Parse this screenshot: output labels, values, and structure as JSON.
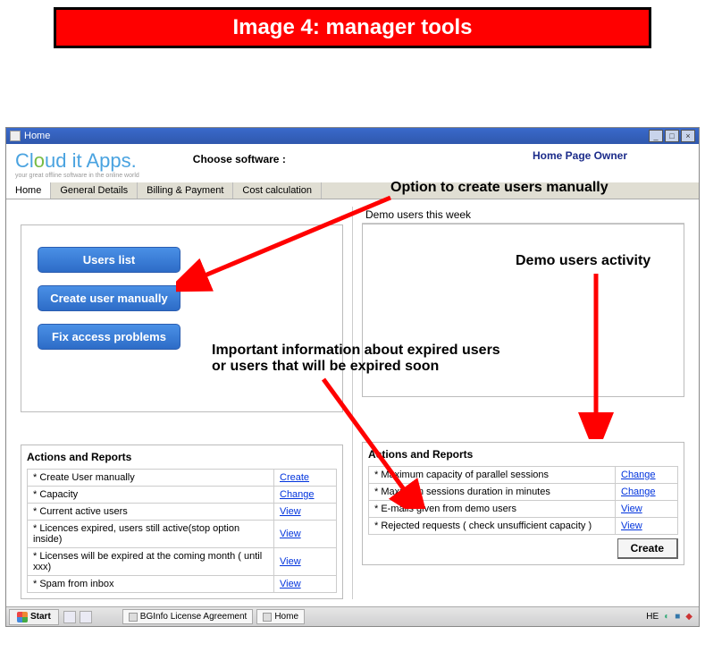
{
  "banner": "Image 4:  manager tools",
  "window_title": "Home",
  "logo": {
    "first": "Cl",
    "o": "o",
    "mid": "ud it Apps.",
    "tagline": "your great offline software in the online world"
  },
  "choose_software": "Choose software :",
  "home_page_owner": "Home Page Owner",
  "tabs": [
    "Home",
    "General Details",
    "Billing & Payment",
    "Cost calculation"
  ],
  "left": {
    "buttons": {
      "users_list": "Users list",
      "create_user": "Create user manually",
      "fix_access": "Fix  access problems"
    }
  },
  "right": {
    "demo_header": "Demo users this  week"
  },
  "reports_left": {
    "title": "Actions and Reports",
    "rows": [
      {
        "label": "* Create User manually",
        "action": "Create"
      },
      {
        "label": "* Capacity",
        "action": "Change"
      },
      {
        "label": "* Current active users",
        "action": "View"
      },
      {
        "label": "* Licences expired, users still active(stop option inside)",
        "action": "View"
      },
      {
        "label": "* Licenses will be expired at the coming month ( until xxx)",
        "action": "View"
      },
      {
        "label": "* Spam from inbox",
        "action": "View"
      }
    ]
  },
  "reports_right": {
    "title": "Actions and Reports",
    "rows": [
      {
        "label": "* Maximum capacity of parallel sessions",
        "action": "Change"
      },
      {
        "label": "* Maximum sessions duration in minutes",
        "action": "Change"
      },
      {
        "label": "* E-mails given from demo users",
        "action": "View"
      },
      {
        "label": "* Rejected requests ( check unsufficient capacity  )",
        "action": "View"
      }
    ],
    "create_button": "Create"
  },
  "taskbar": {
    "start": "Start",
    "items": [
      "BGInfo License Agreement",
      "Home"
    ],
    "lang": "HE"
  },
  "annotations": {
    "create_users": "Option to create  users manually",
    "expired_info": "Important information about expired users\nor users that will be expired soon",
    "demo_activity": "Demo users activity"
  }
}
